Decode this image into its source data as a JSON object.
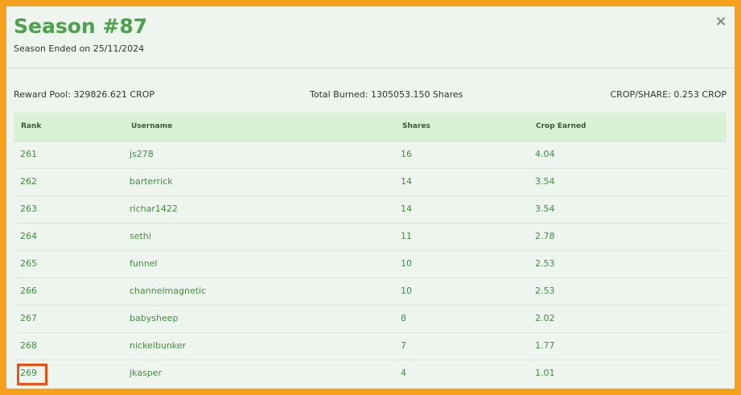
{
  "modal": {
    "title": "Season #87",
    "subtitle": "Season Ended on 25/11/2024",
    "close_glyph": "×"
  },
  "stats": {
    "reward_pool": "Reward Pool: 329826.621 CROP",
    "total_burned": "Total Burned: 1305053.150 Shares",
    "crop_per_share": "CROP/SHARE: 0.253 CROP"
  },
  "table": {
    "headers": [
      "Rank",
      "Username",
      "Shares",
      "Crop Earned"
    ],
    "rows": [
      {
        "rank": "261",
        "username": "js278",
        "shares": "16",
        "crop": "4.04"
      },
      {
        "rank": "262",
        "username": "barterrick",
        "shares": "14",
        "crop": "3.54"
      },
      {
        "rank": "263",
        "username": "richar1422",
        "shares": "14",
        "crop": "3.54"
      },
      {
        "rank": "264",
        "username": "sethi",
        "shares": "11",
        "crop": "2.78"
      },
      {
        "rank": "265",
        "username": "funnel",
        "shares": "10",
        "crop": "2.53"
      },
      {
        "rank": "266",
        "username": "channelmagnetic",
        "shares": "10",
        "crop": "2.53"
      },
      {
        "rank": "267",
        "username": "babysheep",
        "shares": "8",
        "crop": "2.02"
      },
      {
        "rank": "268",
        "username": "nickelbunker",
        "shares": "7",
        "crop": "1.77"
      },
      {
        "rank": "269",
        "username": "jkasper",
        "shares": "4",
        "crop": "1.01"
      }
    ]
  },
  "colors": {
    "frame_border": "#f7a01c",
    "title_green": "#4ca24c",
    "header_row_bg": "#d9f2d5",
    "highlight_border": "#f04e14"
  },
  "icons": {
    "close": "close-icon"
  }
}
